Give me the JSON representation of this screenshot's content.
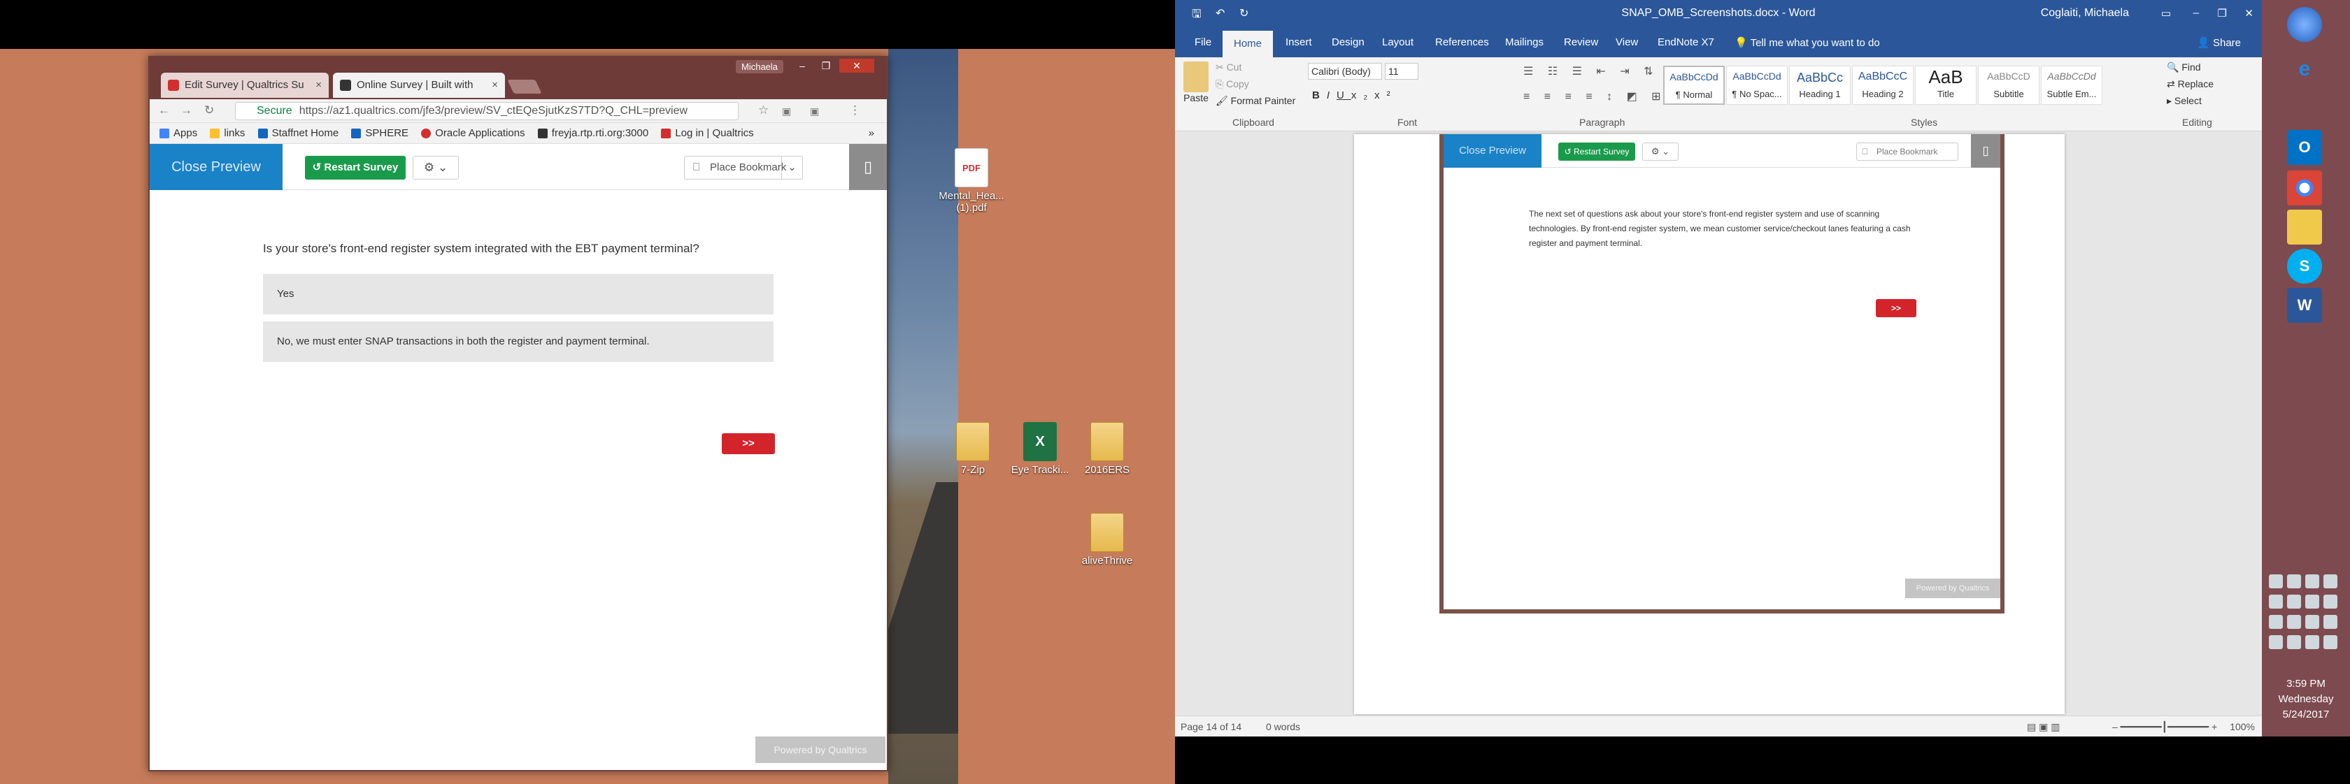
{
  "desktop_left": {
    "icons": [
      {
        "label": "Mental_Hea...\n(1).pdf",
        "icon": "pdf-icon"
      },
      {
        "label": "7-Zip",
        "icon": "folder-icon"
      },
      {
        "label": "Eye Tracki...",
        "icon": "excel-icon"
      },
      {
        "label": "2016ERS",
        "icon": "folder-icon"
      },
      {
        "label": "aliveThrive",
        "icon": "folder-icon"
      }
    ]
  },
  "browser": {
    "user": "Michaela",
    "tabs": [
      {
        "label": "Edit Survey | Qualtrics Su"
      },
      {
        "label": "Online Survey | Built with"
      }
    ],
    "secure_label": "Secure",
    "url": "https://az1.qualtrics.com/jfe3/preview/SV_ctEQeSjutKzS7TD?Q_CHL=preview",
    "bookmarks": [
      "Apps",
      "links",
      "Staffnet Home",
      "SPHERE",
      "Oracle Applications",
      "freyja.rtp.rti.org:3000",
      "Log in | Qualtrics"
    ],
    "overflow": "»"
  },
  "survey_left": {
    "close_preview": "Close Preview",
    "restart": "Restart Survey",
    "gear": "⚙ ⌄",
    "place_bookmark": "Place Bookmark",
    "question": "Is your store's front-end register system integrated with the EBT payment terminal?",
    "choices": [
      "Yes",
      "No, we must enter SNAP transactions in both the register and payment terminal."
    ],
    "next": ">>",
    "powered": "Powered by Qualtrics"
  },
  "word": {
    "title": "SNAP_OMB_Screenshots.docx  -  Word",
    "user": "Coglaiti, Michaela",
    "share": "Share",
    "tabs": [
      "File",
      "Home",
      "Insert",
      "Design",
      "Layout",
      "References",
      "Mailings",
      "Review",
      "View",
      "EndNote X7"
    ],
    "tell_me": "Tell me what you want to do",
    "clipboard": {
      "paste": "Paste",
      "cut": "Cut",
      "copy": "Copy",
      "format_painter": "Format Painter",
      "group": "Clipboard"
    },
    "font": {
      "name": "Calibri (Body)",
      "size": "11",
      "group": "Font"
    },
    "paragraph_group": "Paragraph",
    "styles": [
      {
        "sample": "AaBbCcDd",
        "name": "¶ Normal"
      },
      {
        "sample": "AaBbCcDd",
        "name": "¶ No Spac..."
      },
      {
        "sample": "AaBbCc",
        "name": "Heading 1"
      },
      {
        "sample": "AaBbCcC",
        "name": "Heading 2"
      },
      {
        "sample": "AaB",
        "name": "Title"
      },
      {
        "sample": "AaBbCcD",
        "name": "Subtitle"
      },
      {
        "sample": "AaBbCcDd",
        "name": "Subtle Em..."
      }
    ],
    "styles_group": "Styles",
    "editing": {
      "find": "Find",
      "replace": "Replace",
      "select": "Select",
      "group": "Editing"
    },
    "status": {
      "page": "Page 14 of 14",
      "words": "0 words",
      "zoom": "100%"
    }
  },
  "survey_right": {
    "close_preview": "Close Preview",
    "restart": "Restart Survey",
    "gear": "⚙ ⌄",
    "place_bookmark": "Place Bookmark",
    "intro": "The next set of questions ask about your store's front-end register system and use of scanning technologies. By front-end register system, we mean customer service/checkout lanes featuring a cash register and payment terminal.",
    "next": ">>",
    "powered": "Powered by Qualtrics"
  },
  "taskbar": {
    "time": "3:59 PM",
    "day": "Wednesday",
    "date": "5/24/2017"
  }
}
